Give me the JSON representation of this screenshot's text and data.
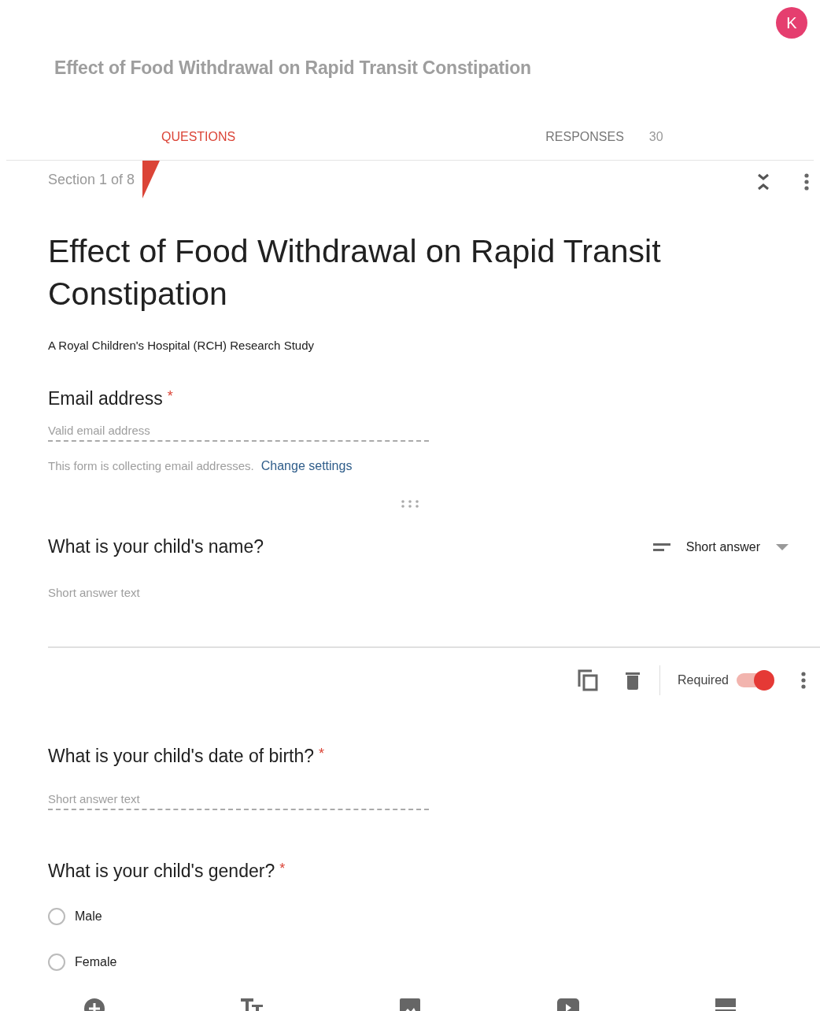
{
  "avatar": {
    "initial": "K"
  },
  "form_name": "Effect of Food Withdrawal on Rapid Transit Constipation",
  "tabs": [
    {
      "label": "QUESTIONS",
      "selected": true
    },
    {
      "label": "RESPONSES",
      "selected": false,
      "count": "30"
    }
  ],
  "section": {
    "label": "Section 1 of 8"
  },
  "title": "Effect of Food Withdrawal on Rapid Transit Constipation",
  "description": "A Royal Children's Hospital (RCH) Research Study",
  "email": {
    "label": "Email address",
    "required_mark": "*",
    "placeholder": "Valid email address",
    "note": "This form is collecting email addresses.",
    "link": "Change settings"
  },
  "questions": [
    {
      "kind": "short",
      "title": "What is your child's name?",
      "active": true,
      "placeholder": "Short answer text",
      "type_label": "Short answer",
      "required_toggle": {
        "label": "Required",
        "on": true
      }
    },
    {
      "kind": "short",
      "title": "What is your child's date of birth?",
      "required_mark": "*",
      "active": false,
      "placeholder": "Short answer text"
    },
    {
      "kind": "choice",
      "title": "What is your child's gender?",
      "required_mark": "*",
      "active": false,
      "options": [
        {
          "label": "Male",
          "selected": false
        },
        {
          "label": "Female",
          "selected": false
        }
      ]
    }
  ]
}
